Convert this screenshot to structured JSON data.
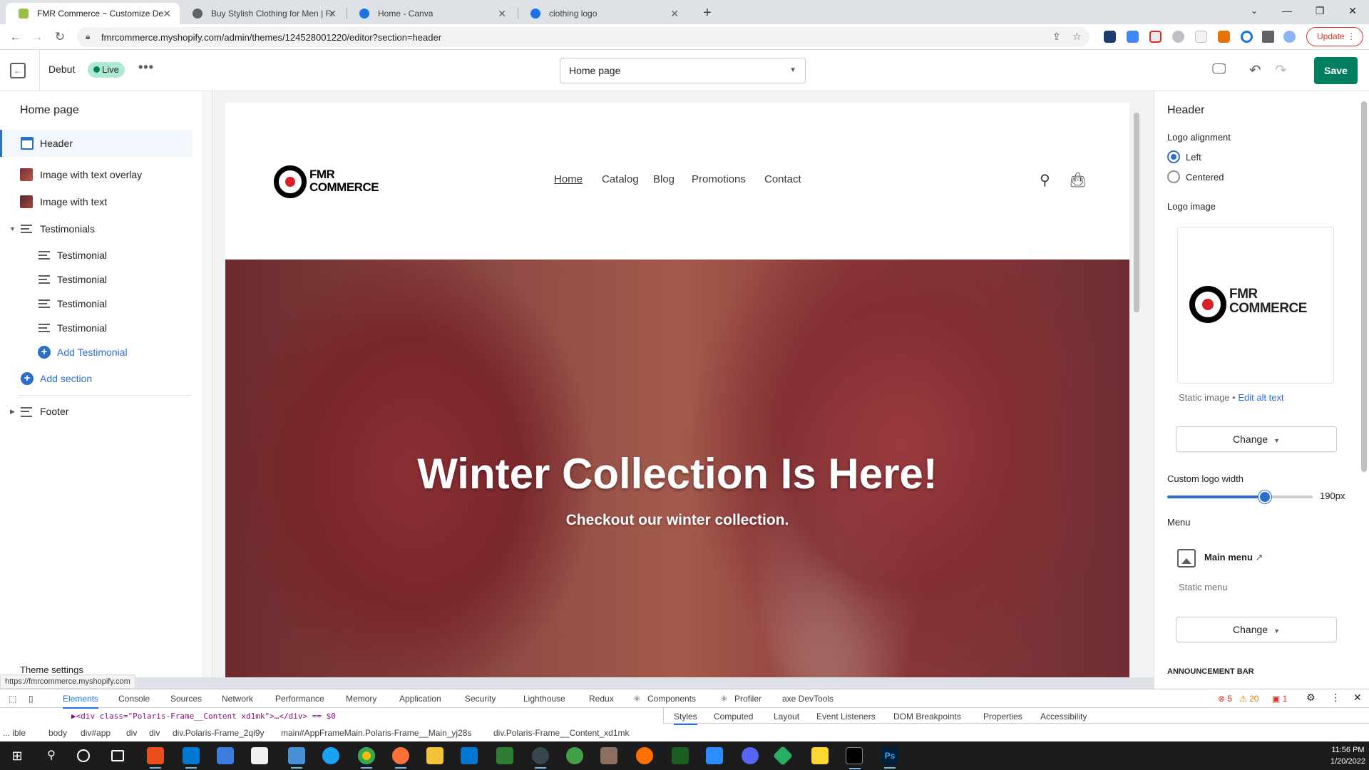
{
  "browser": {
    "tabs": [
      {
        "title": "FMR Commerce ~ Customize De",
        "favicon_color": "#95bf47",
        "active": true
      },
      {
        "title": "Buy Stylish Clothing for Men | Fr",
        "favicon_color": "#5f6368",
        "active": false
      },
      {
        "title": "Home - Canva",
        "favicon_color": "#1a73e8",
        "active": false
      },
      {
        "title": "clothing logo",
        "favicon_color": "#1a73e8",
        "active": false
      }
    ],
    "url": "fmrcommerce.myshopify.com/admin/themes/124528001220/editor?section=header",
    "update_label": "Update",
    "status_url": "https://fmrcommerce.myshopify.com"
  },
  "editor": {
    "theme_name": "Debut",
    "live_label": "Live",
    "page_select": "Home page",
    "save_label": "Save"
  },
  "sidebar": {
    "title": "Home page",
    "items": [
      {
        "label": "Header",
        "icon": "header-section-icon"
      },
      {
        "label": "Image with text overlay",
        "icon": "image-thumbnail-icon"
      },
      {
        "label": "Image with text",
        "icon": "image-thumbnail-icon"
      },
      {
        "label": "Testimonials",
        "icon": "testimonials-section-icon"
      }
    ],
    "testimonials": [
      "Testimonial",
      "Testimonial",
      "Testimonial",
      "Testimonial"
    ],
    "add_testimonial": "Add Testimonial",
    "add_section": "Add section",
    "footer": "Footer",
    "theme_settings": "Theme settings"
  },
  "store": {
    "logo_line1": "FMR",
    "logo_line2": "COMMERCE",
    "nav": [
      "Home",
      "Catalog",
      "Blog",
      "Promotions",
      "Contact"
    ],
    "hero_title": "Winter Collection Is Here!",
    "hero_subtitle": "Checkout our winter collection."
  },
  "settings": {
    "title": "Header",
    "logo_alignment_label": "Logo alignment",
    "alignment_options": [
      "Left",
      "Centered"
    ],
    "selected_alignment": "Left",
    "logo_image_label": "Logo image",
    "static_image": "Static image •",
    "edit_alt_text": "Edit alt text",
    "change_label": "Change",
    "logo_width_label": "Custom logo width",
    "logo_width_value": "190px",
    "logo_width_fraction": 0.67,
    "menu_label": "Menu",
    "main_menu": "Main menu",
    "static_menu": "Static menu",
    "announcement_bar": "ANNOUNCEMENT BAR"
  },
  "devtools": {
    "tabs": [
      "Elements",
      "Console",
      "Sources",
      "Network",
      "Performance",
      "Memory",
      "Application",
      "Security",
      "Lighthouse",
      "Redux",
      "Components",
      "Profiler",
      "axe DevTools"
    ],
    "errors": "5",
    "warnings": "20",
    "issues": "1",
    "code_line": "▶<div class=\"Polaris-Frame__Content xd1mk\">…</div> == $0",
    "breadcrumbs": [
      "... ible",
      "body",
      "div#app",
      "div",
      "div",
      "div.Polaris-Frame_2qi9y",
      "main#AppFrameMain.Polaris-Frame__Main_yj28s",
      "div.Polaris-Frame__Content_xd1mk"
    ],
    "subtabs": [
      "Styles",
      "Computed",
      "Layout",
      "Event Listeners",
      "DOM Breakpoints",
      "Properties",
      "Accessibility"
    ]
  },
  "taskbar": {
    "time": "11:56 PM",
    "date": "1/20/2022"
  }
}
